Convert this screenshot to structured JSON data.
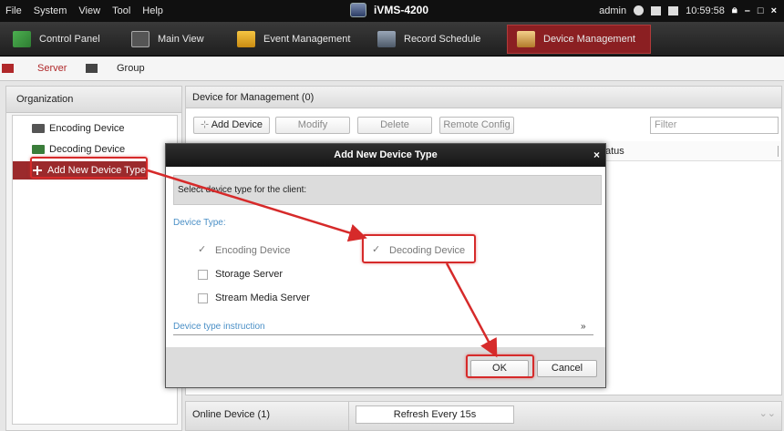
{
  "menubar": {
    "items": [
      "File",
      "System",
      "View",
      "Tool",
      "Help"
    ],
    "app_title": "iVMS-4200",
    "user": "admin",
    "time": "10:59:58"
  },
  "tabs": [
    {
      "label": "Control Panel",
      "icon": "control-panel-icon"
    },
    {
      "label": "Main View",
      "icon": "main-view-icon"
    },
    {
      "label": "Event Management",
      "icon": "event-management-icon"
    },
    {
      "label": "Record Schedule",
      "icon": "record-schedule-icon"
    },
    {
      "label": "Device Management",
      "icon": "device-management-icon",
      "active": true
    }
  ],
  "subtabs": {
    "server": "Server",
    "group": "Group"
  },
  "left": {
    "header": "Organization",
    "items": [
      "Encoding Device",
      "Decoding Device",
      "Add New Device Type"
    ]
  },
  "right": {
    "header": "Device for Management (0)",
    "add_device": "Add Device",
    "modify": "Modify",
    "delete": "Delete",
    "remote_config": "Remote Config",
    "filter_placeholder": "Filter",
    "column_status": "atus"
  },
  "online": {
    "label": "Online Device (1)",
    "refresh": "Refresh Every 15s"
  },
  "dialog": {
    "title": "Add New Device Type",
    "instruction": "Select device type for the client:",
    "section": "Device Type:",
    "options": {
      "encoding": "Encoding Device",
      "decoding": "Decoding Device",
      "storage": "Storage Server",
      "stream": "Stream Media Server"
    },
    "instruction_link": "Device type instruction",
    "ok": "OK",
    "cancel": "Cancel"
  },
  "colors": {
    "accent": "#8b1f22",
    "annotation": "#d62a2a",
    "link": "#4a8fc6"
  }
}
